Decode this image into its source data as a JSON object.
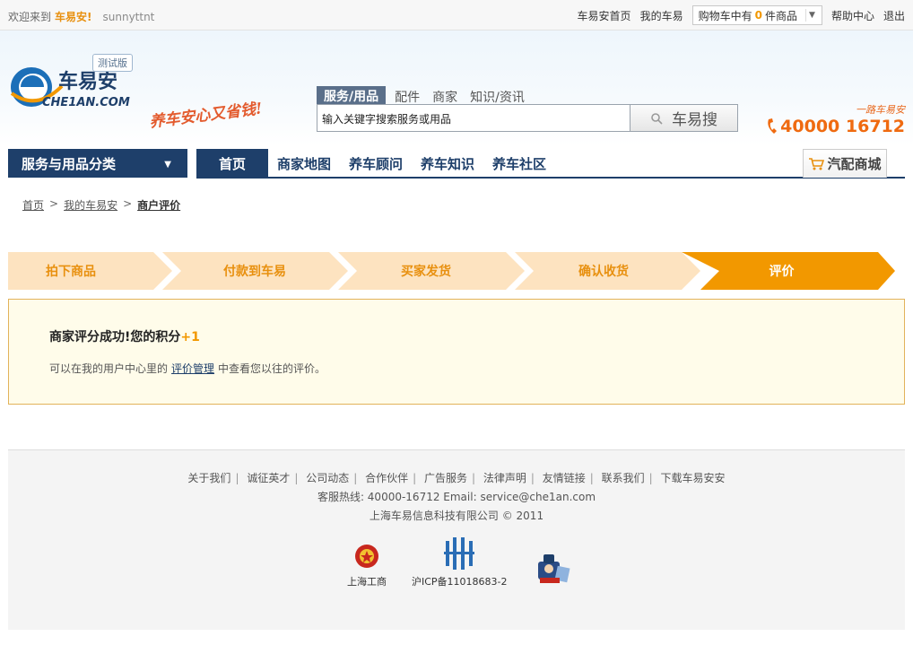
{
  "topbar": {
    "welcome": "欢迎来到",
    "brand": "车易安!",
    "username": "sunnyttnt",
    "links": [
      "车易安首页",
      "我的车易"
    ],
    "cart_prefix": "购物车中有",
    "cart_count": "0",
    "cart_suffix": "件商品",
    "help": "帮助中心",
    "logout": "退出"
  },
  "header": {
    "logo_cn": "车易安",
    "logo_en": "CHE1AN.COM",
    "beta_badge": "测试版",
    "slogan": "养车安心又省钱!",
    "search_tabs": [
      "服务/用品",
      "配件",
      "商家",
      "知识/资讯"
    ],
    "search_placeholder": "输入关键字搜索服务或用品",
    "search_button": "车易搜",
    "hotline_tag": "一路车易安",
    "hotline_number": "40000 16712"
  },
  "nav": {
    "category": "服务与用品分类",
    "items": [
      "首页",
      "商家地图",
      "养车顾问",
      "养车知识",
      "养车社区"
    ],
    "mall": "汽配商城"
  },
  "breadcrumb": [
    "首页",
    "我的车易安",
    "商户评价"
  ],
  "steps": [
    "拍下商品",
    "付款到车易",
    "买家发货",
    "确认收货",
    "评价"
  ],
  "colors": {
    "step_inactive": "#fde3c0",
    "step_active": "#f29800",
    "nav": "#1e3f6a"
  },
  "success": {
    "title": "商家评分成功!您的积分",
    "points": "+1",
    "desc_before": "可以在我的用户中心里的",
    "desc_link": "评价管理",
    "desc_after": "中查看您以往的评价。"
  },
  "footer": {
    "links": [
      "关于我们",
      "诚征英才",
      "公司动态",
      "合作伙伴",
      "广告服务",
      "法律声明",
      "友情链接",
      "联系我们",
      "下载车易安安"
    ],
    "contact": "客服热线: 40000-16712 Email: service@che1an.com",
    "copyright": "上海车易信息科技有限公司 © 2011",
    "badge1": "上海工商",
    "badge2": "沪ICP备11018683-2"
  }
}
